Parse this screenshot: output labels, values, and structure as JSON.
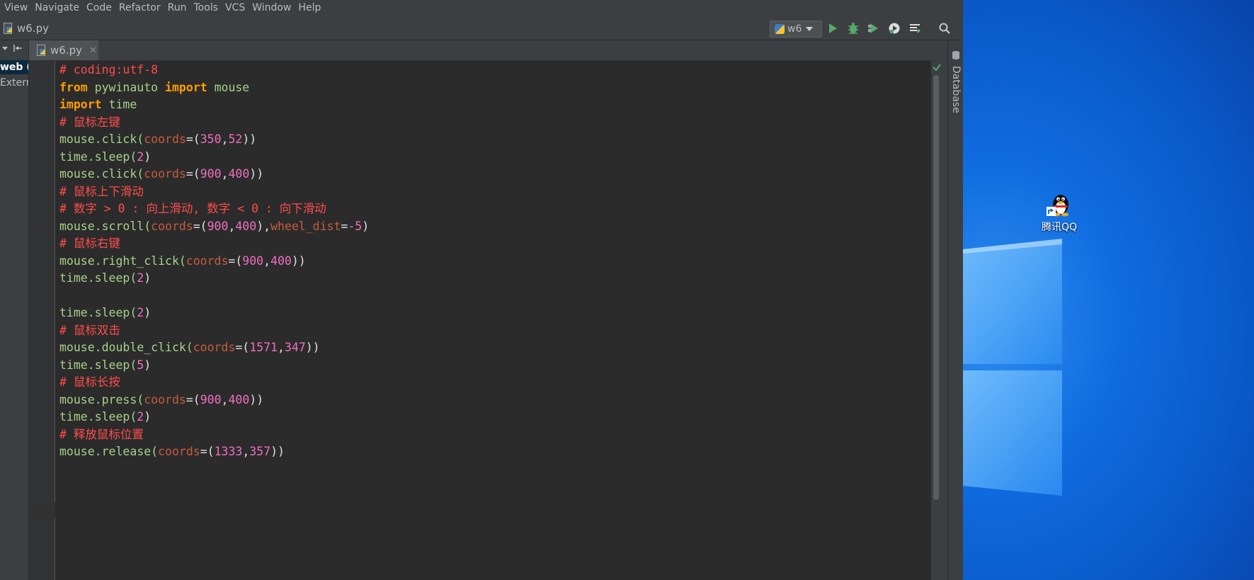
{
  "menubar": {
    "items": [
      "View",
      "Navigate",
      "Code",
      "Refactor",
      "Run",
      "Tools",
      "VCS",
      "Window",
      "Help"
    ]
  },
  "navbar": {
    "file_label": "w6.py",
    "run_config": "w6"
  },
  "project": {
    "root_label": "web (",
    "external_label": "Extern"
  },
  "tabs": [
    {
      "label": "w6.py",
      "active": true
    }
  ],
  "tool_windows": {
    "right": "Database"
  },
  "editor": {
    "lines": [
      [
        {
          "t": "cm",
          "v": "# coding:utf-8"
        }
      ],
      [
        {
          "t": "kw",
          "v": "from"
        },
        {
          "t": "id",
          "v": " pywinauto "
        },
        {
          "t": "kw",
          "v": "import"
        },
        {
          "t": "id",
          "v": " mouse"
        }
      ],
      [
        {
          "t": "kw",
          "v": "import"
        },
        {
          "t": "id",
          "v": " time"
        }
      ],
      [
        {
          "t": "cm",
          "v": "# 鼠标左键"
        }
      ],
      [
        {
          "t": "id",
          "v": "mouse.click("
        },
        {
          "t": "param",
          "v": "coords"
        },
        {
          "t": "op",
          "v": "=("
        },
        {
          "t": "num",
          "v": "350"
        },
        {
          "t": "op",
          "v": ","
        },
        {
          "t": "num",
          "v": "52"
        },
        {
          "t": "op",
          "v": "))"
        }
      ],
      [
        {
          "t": "id",
          "v": "time.sleep("
        },
        {
          "t": "num",
          "v": "2"
        },
        {
          "t": "op",
          "v": ")"
        }
      ],
      [
        {
          "t": "id",
          "v": "mouse.click("
        },
        {
          "t": "param",
          "v": "coords"
        },
        {
          "t": "op",
          "v": "=("
        },
        {
          "t": "num",
          "v": "900"
        },
        {
          "t": "op",
          "v": ","
        },
        {
          "t": "num",
          "v": "400"
        },
        {
          "t": "op",
          "v": "))"
        }
      ],
      [
        {
          "t": "cm",
          "v": "# 鼠标上下滑动"
        }
      ],
      [
        {
          "t": "cm",
          "v": "# 数字 > 0 : 向上滑动, 数字 < 0 : 向下滑动"
        }
      ],
      [
        {
          "t": "id",
          "v": "mouse.scroll("
        },
        {
          "t": "param",
          "v": "coords"
        },
        {
          "t": "op",
          "v": "=("
        },
        {
          "t": "num",
          "v": "900"
        },
        {
          "t": "op",
          "v": ","
        },
        {
          "t": "num",
          "v": "400"
        },
        {
          "t": "op",
          "v": "),"
        },
        {
          "t": "param",
          "v": "wheel_dist"
        },
        {
          "t": "op",
          "v": "="
        },
        {
          "t": "num",
          "v": "-5"
        },
        {
          "t": "op",
          "v": ")"
        }
      ],
      [
        {
          "t": "cm",
          "v": "# 鼠标右键"
        }
      ],
      [
        {
          "t": "id",
          "v": "mouse.right_click("
        },
        {
          "t": "param",
          "v": "coords"
        },
        {
          "t": "op",
          "v": "=("
        },
        {
          "t": "num",
          "v": "900"
        },
        {
          "t": "op",
          "v": ","
        },
        {
          "t": "num",
          "v": "400"
        },
        {
          "t": "op",
          "v": "))"
        }
      ],
      [
        {
          "t": "id",
          "v": "time.sleep("
        },
        {
          "t": "num",
          "v": "2"
        },
        {
          "t": "op",
          "v": ")"
        }
      ],
      [],
      [
        {
          "t": "id",
          "v": "time.sleep("
        },
        {
          "t": "num",
          "v": "2"
        },
        {
          "t": "op",
          "v": ")"
        }
      ],
      [
        {
          "t": "cm",
          "v": "# 鼠标双击"
        }
      ],
      [
        {
          "t": "id",
          "v": "mouse.double_click("
        },
        {
          "t": "param",
          "v": "coords"
        },
        {
          "t": "op",
          "v": "=("
        },
        {
          "t": "num",
          "v": "1571"
        },
        {
          "t": "op",
          "v": ","
        },
        {
          "t": "num",
          "v": "347"
        },
        {
          "t": "op",
          "v": "))"
        }
      ],
      [
        {
          "t": "id",
          "v": "time.sleep("
        },
        {
          "t": "num",
          "v": "5"
        },
        {
          "t": "op",
          "v": ")"
        }
      ],
      [
        {
          "t": "cm",
          "v": "# 鼠标长按"
        }
      ],
      [
        {
          "t": "id",
          "v": "mouse.press("
        },
        {
          "t": "param",
          "v": "coords"
        },
        {
          "t": "op",
          "v": "=("
        },
        {
          "t": "num",
          "v": "900"
        },
        {
          "t": "op",
          "v": ","
        },
        {
          "t": "num",
          "v": "400"
        },
        {
          "t": "op",
          "v": "))"
        }
      ],
      [
        {
          "t": "id",
          "v": "time.sleep("
        },
        {
          "t": "num",
          "v": "2"
        },
        {
          "t": "op",
          "v": ")"
        }
      ],
      [
        {
          "t": "cm",
          "v": "# 释放鼠标位置"
        }
      ],
      [
        {
          "t": "id",
          "v": "mouse.release("
        },
        {
          "t": "param",
          "v": "coords"
        },
        {
          "t": "op",
          "v": "=("
        },
        {
          "t": "num",
          "v": "1333"
        },
        {
          "t": "op",
          "v": ","
        },
        {
          "t": "num",
          "v": "357"
        },
        {
          "t": "op",
          "v": "))"
        }
      ]
    ]
  },
  "desktop": {
    "shortcut_label": "腾讯QQ"
  },
  "colors": {
    "comment": "#ff4c4c",
    "keyword": "#ff9d00",
    "identifier": "#a8d18a",
    "param": "#c75c3c",
    "number": "#ef6fbf",
    "editor_bg": "#2b2b2b",
    "desktop_blue": "#0a58c8"
  }
}
